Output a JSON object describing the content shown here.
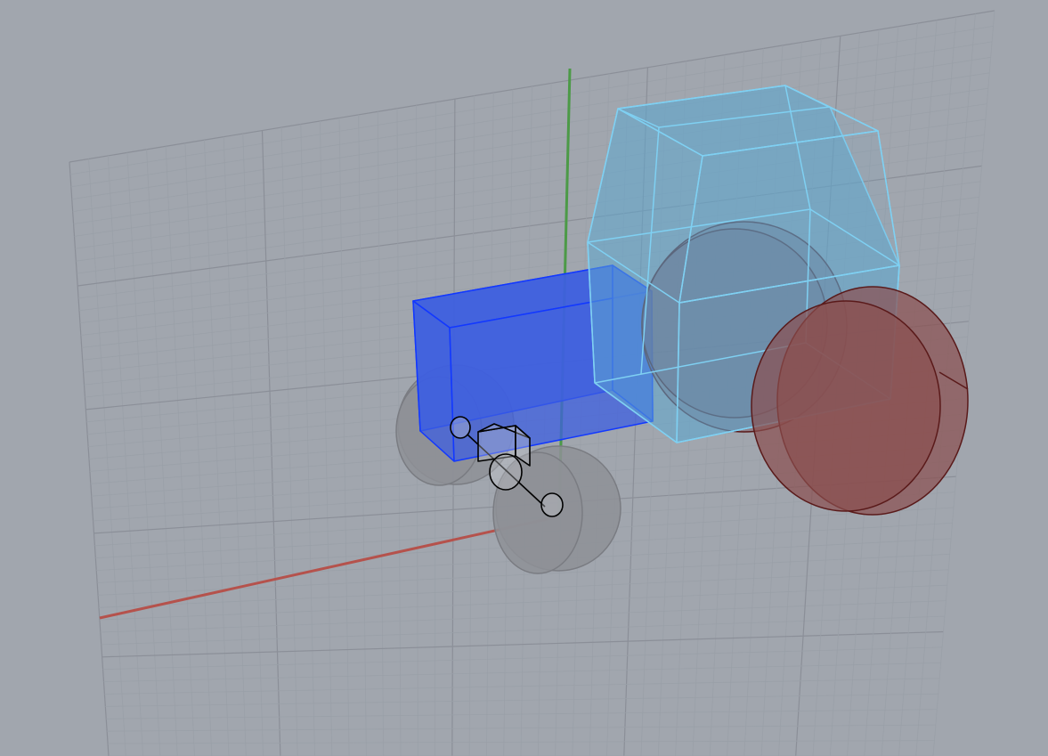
{
  "viewport": {
    "view": "perspective",
    "background_color": "#a1a6ae",
    "grid_minor_color": "#9aa0a8",
    "grid_major_color": "#8b8f98",
    "x_axis_color": "#b5524c",
    "y_axis_color": "#4c9a47"
  },
  "objects": [
    {
      "name": "cabin",
      "shape": "tapered-box",
      "fill": "#5fa8cf",
      "edge": "#7fd0f2",
      "state": "selected"
    },
    {
      "name": "hood",
      "shape": "box",
      "fill": "#3d5fe0",
      "edge": "#1238ff",
      "state": "selected"
    },
    {
      "name": "rear-wheel-left",
      "shape": "cylinder",
      "fill": "#7b4f5a",
      "edge": "#5a1a1a",
      "state": "highlighted"
    },
    {
      "name": "rear-wheel-right",
      "shape": "cylinder",
      "fill": "#8a4f4f",
      "edge": "#5a1a1a",
      "state": "highlighted"
    },
    {
      "name": "front-wheel-left",
      "shape": "cylinder",
      "fill": "#8e9097",
      "edge": "#7a7c82",
      "state": "normal"
    },
    {
      "name": "front-wheel-right",
      "shape": "cylinder",
      "fill": "#8e9097",
      "edge": "#7a7c82",
      "state": "normal"
    },
    {
      "name": "front-axle",
      "shape": "wireframe",
      "fill": "none",
      "edge": "#000000",
      "state": "normal"
    }
  ]
}
